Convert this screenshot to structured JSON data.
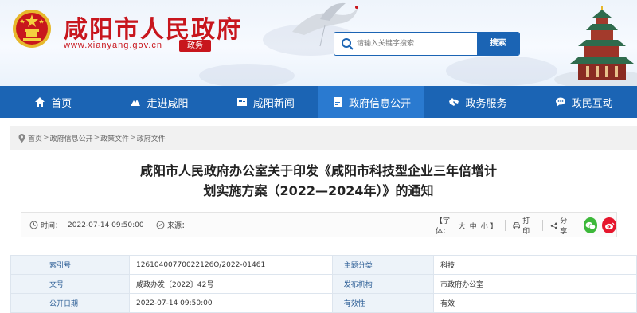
{
  "header": {
    "site_title": "咸阳市人民政府",
    "site_url": "www.xianyang.gov.cn",
    "gov_badge": "政务",
    "search": {
      "placeholder": "请输入关键字搜索",
      "button_label": "搜索"
    },
    "colors": {
      "brand_red": "#c8161d",
      "nav_blue": "#1b64b4",
      "nav_active": "#2a7ad0"
    }
  },
  "nav": {
    "items": [
      {
        "label": "首页",
        "icon": "home-icon"
      },
      {
        "label": "走进咸阳",
        "icon": "mountain-icon"
      },
      {
        "label": "咸阳新闻",
        "icon": "newspaper-icon"
      },
      {
        "label": "政府信息公开",
        "icon": "document-icon",
        "active": true
      },
      {
        "label": "政务服务",
        "icon": "handshake-icon"
      },
      {
        "label": "政民互动",
        "icon": "chat-icon"
      }
    ]
  },
  "breadcrumb": {
    "items": [
      "首页",
      "政府信息公开",
      "政策文件",
      "政府文件"
    ],
    "separator": ">"
  },
  "article": {
    "title_line1": "咸阳市人民政府办公室关于印发《咸阳市科技型企业三年倍增计",
    "title_line2": "划实施方案（2022—2024年）》的通知"
  },
  "meta": {
    "time_label": "时间：",
    "time_value": "2022-07-14 09:50:00",
    "source_label": "来源：",
    "font_label": "【字体：",
    "font_large": "大",
    "font_medium": "中",
    "font_small": "小",
    "font_close": "】",
    "print_label": "打印",
    "share_label": "分享："
  },
  "info_table": {
    "rows": [
      {
        "label1": "索引号",
        "value1": "12610400770022126O/2022-01461",
        "label2": "主题分类",
        "value2": "科技"
      },
      {
        "label1": "文号",
        "value1": "咸政办发〔2022〕42号",
        "label2": "发布机构",
        "value2": "市政府办公室"
      },
      {
        "label1": "公开日期",
        "value1": "2022-07-14 09:50:00",
        "label2": "有效性",
        "value2": "有效"
      }
    ]
  }
}
